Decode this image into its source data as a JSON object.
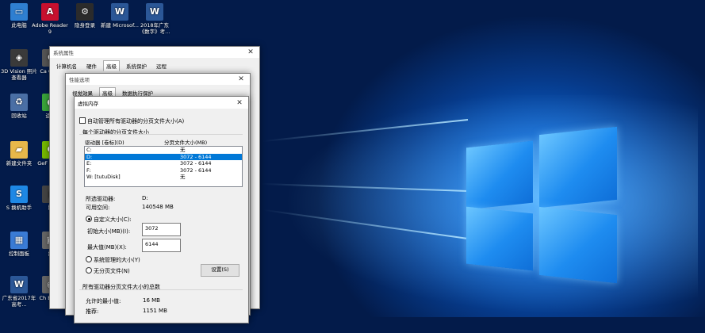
{
  "desktop": {
    "icons": [
      {
        "name": "this-pc",
        "label": "此电脑",
        "color": "#2f7fd1",
        "glyph": "▭"
      },
      {
        "name": "adobe-reader",
        "label": "Adobe Reader 9",
        "color": "#c8102e",
        "glyph": "A"
      },
      {
        "name": "hidden-logon",
        "label": "隐身登录",
        "color": "#2b2b2b",
        "glyph": "⚙"
      },
      {
        "name": "new-word-doc",
        "label": "新建 Microsof...",
        "color": "#2b5797",
        "glyph": "W"
      },
      {
        "name": "word-doc-2018",
        "label": "2018年广东《数字》考...",
        "color": "#2b5797",
        "glyph": "W"
      },
      {
        "name": "3d-vision",
        "label": "3D Vision 照片查看器",
        "color": "#3a3a3a",
        "glyph": "◈"
      },
      {
        "name": "canon",
        "label": "Ca Cano",
        "color": "#555",
        "glyph": "C"
      },
      {
        "name": "recycle-bin",
        "label": "回收站",
        "color": "#4a6fa5",
        "glyph": "♻"
      },
      {
        "name": "green-app",
        "label": "运动",
        "color": "#3aa53a",
        "glyph": "●"
      },
      {
        "name": "new-folder",
        "label": "新建文件夹",
        "color": "#e8b84a",
        "glyph": "▰"
      },
      {
        "name": "geforce",
        "label": "GeF Exper",
        "color": "#76b900",
        "glyph": "G"
      },
      {
        "name": "assistant",
        "label": "S 换机助手",
        "color": "#1e88e5",
        "glyph": "S"
      },
      {
        "name": "phone",
        "label": "腾",
        "color": "#444",
        "glyph": "▮"
      },
      {
        "name": "control-panel",
        "label": "控制面板",
        "color": "#3a7bd5",
        "glyph": "▦"
      },
      {
        "name": "misc",
        "label": "控",
        "color": "#666",
        "glyph": "▣"
      },
      {
        "name": "gd-doc-2017",
        "label": "广东省2017年高考...",
        "color": "#2b5797",
        "glyph": "W"
      },
      {
        "name": "chrome",
        "label": "Ch Engin",
        "color": "#666",
        "glyph": "◉"
      }
    ]
  },
  "sysprops": {
    "title": "系统属性",
    "tabs": [
      "计算机名",
      "硬件",
      "高级",
      "系统保护",
      "远程"
    ],
    "active_tab": "高级"
  },
  "perfopts": {
    "title": "性能选项",
    "tabs": [
      "视觉效果",
      "高级",
      "数据执行保护"
    ]
  },
  "vmem": {
    "title": "虚拟内存",
    "auto_manage_label": "自动管理所有驱动器的分页文件大小(A)",
    "group_label": "每个驱动器的分页文件大小",
    "col_drive": "驱动器 [卷标](D)",
    "col_size": "分页文件大小(MB)",
    "drives": [
      {
        "drive": "C:",
        "size": "无"
      },
      {
        "drive": "D:",
        "size": "3072 - 6144"
      },
      {
        "drive": "E:",
        "size": "3072 - 6144"
      },
      {
        "drive": "F:",
        "size": "3072 - 6144"
      },
      {
        "drive": "W:     [tutuDisk]",
        "size": "无"
      }
    ],
    "selected_row": 1,
    "selected_drive_label": "所选驱动器:",
    "selected_drive_value": "D:",
    "free_space_label": "可用空间:",
    "free_space_value": "140548 MB",
    "custom_size_label": "自定义大小(C):",
    "initial_size_label": "初始大小(MB)(I):",
    "initial_size_value": "3072",
    "max_size_label": "最大值(MB)(X):",
    "max_size_value": "6144",
    "system_managed_label": "系统管理的大小(Y)",
    "no_paging_label": "无分页文件(N)",
    "set_button": "设置(S)",
    "total_group_label": "所有驱动器分页文件大小的总数",
    "min_allowed_label": "允许的最小值:",
    "min_allowed_value": "16 MB",
    "recommended_label": "推荐:",
    "recommended_value": "1151 MB"
  }
}
